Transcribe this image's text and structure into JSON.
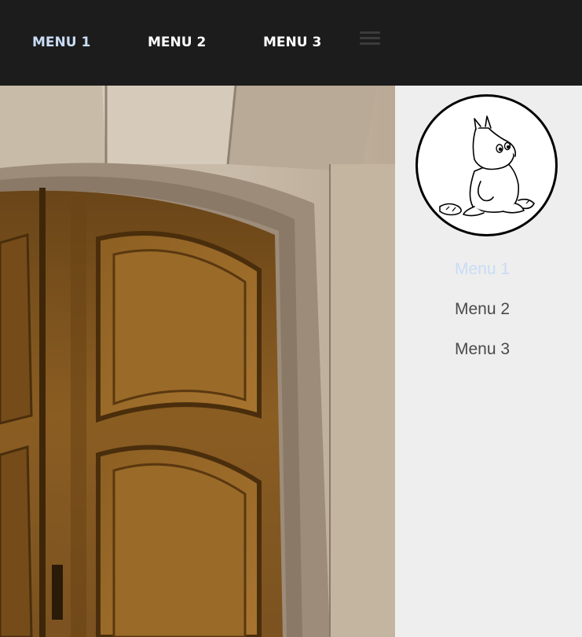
{
  "topnav": {
    "items": [
      {
        "label": "MENU 1",
        "active": true
      },
      {
        "label": "MENU 2",
        "active": false
      },
      {
        "label": "MENU 3",
        "active": false
      }
    ],
    "menu_icon": "hamburger-menu-icon"
  },
  "hero": {
    "image": "wooden-arched-door-photo"
  },
  "sidebar": {
    "avatar": "moomin-character-illustration",
    "items": [
      {
        "label": "Menu 1",
        "active": true
      },
      {
        "label": "Menu 2",
        "active": false
      },
      {
        "label": "Menu 3",
        "active": false
      }
    ]
  },
  "colors": {
    "topbar": "#1c1c1c",
    "active": "#c9dcf5",
    "sidebar_bg": "#eeeeee",
    "sidebar_text": "#4a4a4a"
  }
}
